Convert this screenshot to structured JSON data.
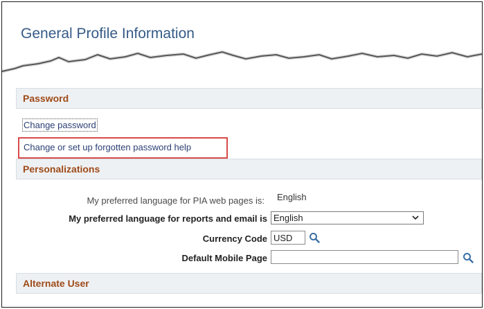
{
  "page": {
    "title": "General Profile Information"
  },
  "password_section": {
    "heading": "Password",
    "change_password_link": "Change password",
    "forgotten_help_link": "Change or set up forgotten password help"
  },
  "personalizations_section": {
    "heading": "Personalizations",
    "pia_language_label": "My preferred language for PIA web pages is:",
    "pia_language_value": "English",
    "report_language_label": "My preferred language for reports and email is",
    "report_language_selected": "English",
    "currency_label": "Currency Code",
    "currency_value": "USD",
    "mobile_page_label": "Default Mobile Page",
    "mobile_page_value": ""
  },
  "alternate_user_section": {
    "heading": "Alternate User"
  },
  "icons": {
    "lookup": "magnifier-lookup-icon",
    "dropdown": "chevron-down-icon"
  },
  "colors": {
    "title": "#355a86",
    "section_heading": "#9e4a17",
    "link": "#2b3f74",
    "highlight": "#d94a4a"
  }
}
